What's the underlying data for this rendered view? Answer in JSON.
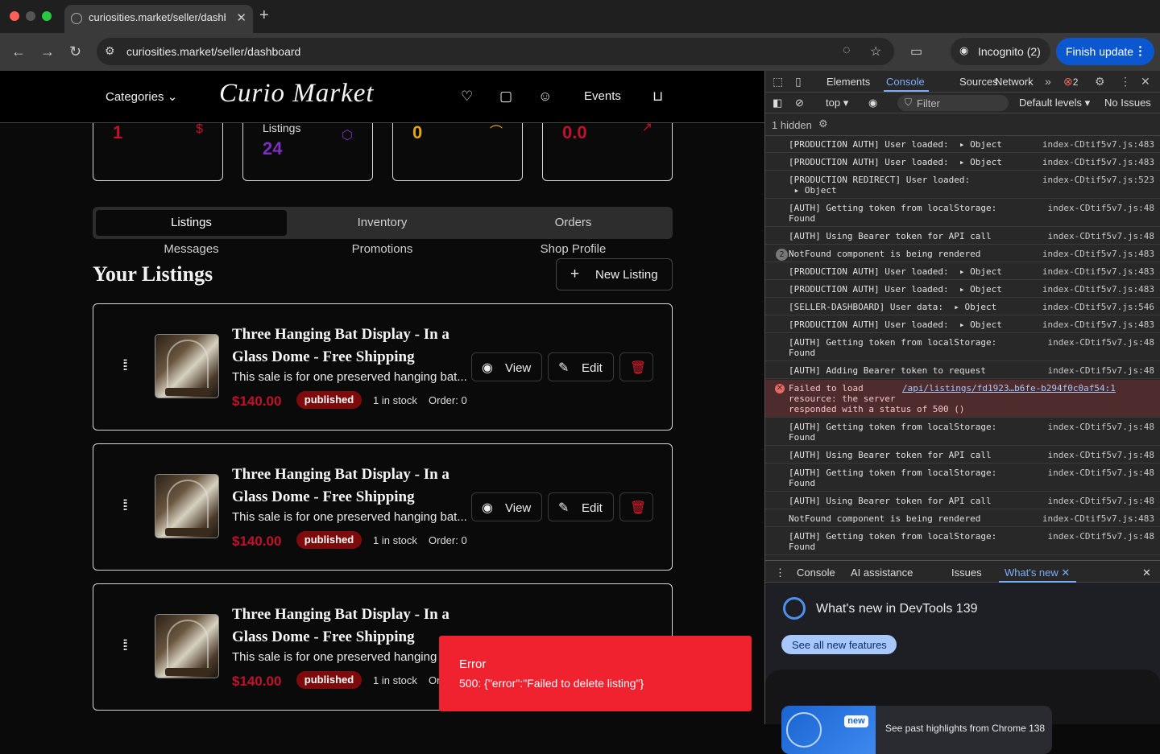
{
  "browser": {
    "tab_title": "curiosities.market/seller/dashb",
    "url": "curiosities.market/seller/dashboard",
    "incognito_label": "Incognito (2)",
    "finish_update_label": "Finish update"
  },
  "site": {
    "categories_label": "Categories",
    "logo_text": "Curio Market",
    "events_label": "Events"
  },
  "stats": [
    {
      "label": "",
      "value": "1",
      "color": "#c0122a",
      "icon": "dollar-icon"
    },
    {
      "label": "Listings",
      "value": "24",
      "color": "#7b2fbe",
      "icon": "box-icon"
    },
    {
      "label": "",
      "value": "0",
      "color": "#e3a413",
      "icon": "users-icon"
    },
    {
      "label": "",
      "value": "0.0",
      "color": "#c0122a",
      "icon": "trend-icon"
    }
  ],
  "tabs": {
    "row1": [
      "Listings",
      "Inventory",
      "Orders"
    ],
    "row2": [
      "Messages",
      "Promotions",
      "Shop Profile"
    ],
    "active": "Listings"
  },
  "listings_heading": "Your Listings",
  "new_listing_label": "New Listing",
  "listings": [
    {
      "title": "Three Hanging Bat Display - In a Glass Dome - Free Shipping",
      "description": "This sale is for one preserved hanging bat...",
      "price": "$140.00",
      "status": "published",
      "stock": "1 in stock",
      "order": "Order: 0"
    },
    {
      "title": "Three Hanging Bat Display - In a Glass Dome - Free Shipping",
      "description": "This sale is for one preserved hanging bat...",
      "price": "$140.00",
      "status": "published",
      "stock": "1 in stock",
      "order": "Order: 0"
    },
    {
      "title": "Three Hanging Bat Display - In a Glass Dome - Free Shipping",
      "description": "This sale is for one preserved hanging",
      "price": "$140.00",
      "status": "published",
      "stock": "1 in stock",
      "order": "Or"
    }
  ],
  "actions": {
    "view": "View",
    "edit": "Edit"
  },
  "toast": {
    "title": "Error",
    "message": "500: {\"error\":\"Failed to delete listing\"}"
  },
  "devtools": {
    "tabs": [
      "Elements",
      "Console",
      "Sources",
      "Network"
    ],
    "active_tab": "Console",
    "error_count": "2",
    "context": "top",
    "filter_placeholder": "Filter",
    "levels": "Default levels",
    "issues": "No Issues",
    "hidden": "1 hidden",
    "logs": [
      {
        "msg": "[PRODUCTION AUTH] User loaded:  ▸ Object",
        "src": "index-CDtif5v7.js:483",
        "type": "log",
        "lines": 1
      },
      {
        "msg": "[PRODUCTION AUTH] User loaded:  ▸ Object",
        "src": "index-CDtif5v7.js:483",
        "type": "log",
        "lines": 1
      },
      {
        "msg": "[PRODUCTION REDIRECT] User loaded:\n ▸ Object",
        "src": "index-CDtif5v7.js:523",
        "type": "log",
        "lines": 2
      },
      {
        "msg": "[AUTH] Getting token from localStorage:\nFound",
        "src": "index-CDtif5v7.js:48",
        "type": "log",
        "lines": 2
      },
      {
        "msg": "[AUTH] Using Bearer token for API call",
        "src": "index-CDtif5v7.js:48",
        "type": "log",
        "lines": 1
      },
      {
        "msg": "NotFound component is being rendered",
        "src": "index-CDtif5v7.js:483",
        "type": "count",
        "count": "2",
        "lines": 1
      },
      {
        "msg": "[PRODUCTION AUTH] User loaded:  ▸ Object",
        "src": "index-CDtif5v7.js:483",
        "type": "log",
        "lines": 1
      },
      {
        "msg": "[PRODUCTION AUTH] User loaded:  ▸ Object",
        "src": "index-CDtif5v7.js:483",
        "type": "log",
        "lines": 1
      },
      {
        "msg": "[SELLER-DASHBOARD] User data:  ▸ Object",
        "src": "index-CDtif5v7.js:546",
        "type": "log",
        "lines": 1
      },
      {
        "msg": "[PRODUCTION AUTH] User loaded:  ▸ Object",
        "src": "index-CDtif5v7.js:483",
        "type": "log",
        "lines": 1
      },
      {
        "msg": "[AUTH] Getting token from localStorage:\nFound",
        "src": "index-CDtif5v7.js:48",
        "type": "log",
        "lines": 2
      },
      {
        "msg": "[AUTH] Adding Bearer token to request",
        "src": "index-CDtif5v7.js:48",
        "type": "log",
        "lines": 1
      },
      {
        "msg": "Failed to load\nresource: the server\nresponded with a status of 500 ()",
        "src": "/api/listings/fd1923…b6fe-b294f0c0af54:1",
        "type": "error",
        "lines": 3
      },
      {
        "msg": "[AUTH] Getting token from localStorage:\nFound",
        "src": "index-CDtif5v7.js:48",
        "type": "log",
        "lines": 2
      },
      {
        "msg": "[AUTH] Using Bearer token for API call",
        "src": "index-CDtif5v7.js:48",
        "type": "log",
        "lines": 1
      },
      {
        "msg": "[AUTH] Getting token from localStorage:\nFound",
        "src": "index-CDtif5v7.js:48",
        "type": "log",
        "lines": 2
      },
      {
        "msg": "[AUTH] Using Bearer token for API call",
        "src": "index-CDtif5v7.js:48",
        "type": "log",
        "lines": 1
      },
      {
        "msg": "NotFound component is being rendered",
        "src": "index-CDtif5v7.js:483",
        "type": "log",
        "lines": 1
      },
      {
        "msg": "[AUTH] Getting token from localStorage:\nFound",
        "src": "index-CDtif5v7.js:48",
        "type": "log",
        "lines": 2
      }
    ],
    "drawer_tabs": [
      "Console",
      "AI assistance",
      "Issues",
      "What's new"
    ],
    "drawer_active": "What's new",
    "whats_new_title": "What's new in DevTools 139",
    "see_all_label": "See all new features",
    "highlight_badge": "new",
    "highlight_text": "See past highlights from Chrome 138"
  }
}
